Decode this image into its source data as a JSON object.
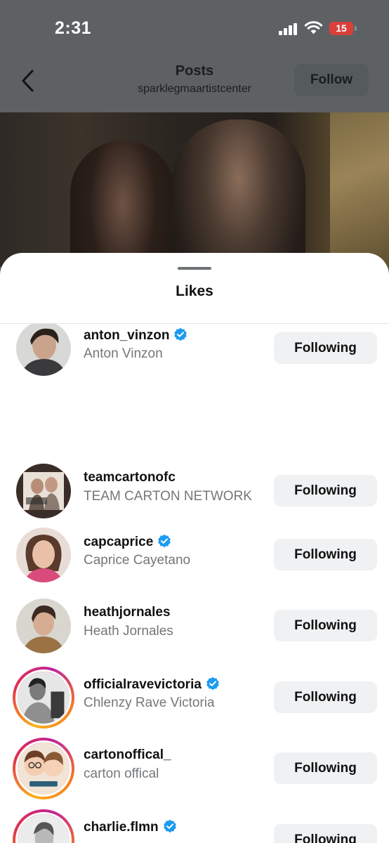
{
  "status_bar": {
    "time": "2:31",
    "battery": "15"
  },
  "header": {
    "title": "Posts",
    "subtitle": "sparklegmaartistcenter",
    "follow_label": "Follow"
  },
  "sheet": {
    "title": "Likes"
  },
  "likes": [
    {
      "username": "anton_vinzon",
      "full_name": "Anton Vinzon",
      "verified": true,
      "button": "Following",
      "story_ring": false
    },
    {
      "username": "teamcartonofc",
      "full_name": "TEAM CARTON NETWORK",
      "verified": false,
      "button": "Following",
      "story_ring": false
    },
    {
      "username": "capcaprice",
      "full_name": "Caprice Cayetano",
      "verified": true,
      "button": "Following",
      "story_ring": false
    },
    {
      "username": "heathjornales",
      "full_name": "Heath Jornales",
      "verified": false,
      "button": "Following",
      "story_ring": false
    },
    {
      "username": "officialravevictoria",
      "full_name": "Chlenzy Rave Victoria",
      "verified": true,
      "button": "Following",
      "story_ring": true
    },
    {
      "username": "cartonoffical_",
      "full_name": "carton offical",
      "verified": false,
      "button": "Following",
      "story_ring": true
    },
    {
      "username": "charlie.flmn",
      "full_name": "",
      "verified": true,
      "button": "Following",
      "story_ring": true
    }
  ],
  "colors": {
    "accent_verified": "#1d9bf0",
    "button_bg": "#eff1f3",
    "overlay": "#5d6163"
  }
}
